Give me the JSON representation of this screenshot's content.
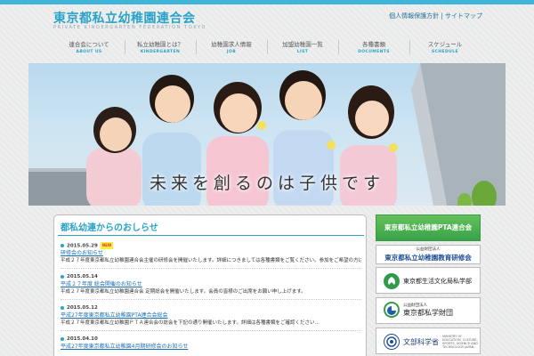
{
  "header": {
    "logo_title": "東京都私立幼稚園連合会",
    "logo_subtitle": "PRIVATE KINDERGARTEN FEDERATION TOKYO",
    "links": [
      "個人情報保護方針",
      "サイトマップ"
    ],
    "link_separator": "|"
  },
  "nav": [
    {
      "ja": "連合会について",
      "en": "ABOUT US"
    },
    {
      "ja": "私立幼稚園とは？",
      "en": "KINDERGARTEN"
    },
    {
      "ja": "幼稚園求人情報",
      "en": "JOB"
    },
    {
      "ja": "加盟幼稚園一覧",
      "en": "LIST"
    },
    {
      "ja": "各種書類",
      "en": "DOCUMENTS"
    },
    {
      "ja": "スケジュール",
      "en": "SCHEDULE"
    }
  ],
  "hero": {
    "caption": "未来を創るのは子供です"
  },
  "news": {
    "title": "都私幼連からのおしらせ",
    "items": [
      {
        "date": "2015.05.29",
        "badge": "NEW",
        "link": "研修会のお知らせ",
        "body": "平成２７年度東京都私立幼稚園連合会主催の研修会を開催いたします。詳細につきましては各種書類をご覧ください。参加をご希望の方は　…　詳細"
      },
      {
        "date": "2015.05.14",
        "badge": "",
        "link": "平成２７年度 総会開催のお知らせ",
        "body": "平成２７年度東京都私立幼稚園連合会 定期総会を開催いたします。会員の皆様のご出席をお願い申し上げます。"
      },
      {
        "date": "2015.05.12",
        "badge": "",
        "link": "平成27年度東京都私立幼稚園PTA連合会総会",
        "body": "平成２７年度東京都私立幼稚園ＰＴＡ連合会の総会を下記の通り開催いたします。詳細は各種書類をご確認ください…"
      },
      {
        "date": "2015.04.10",
        "badge": "",
        "link": "平成27年度東京都私立幼稚園4月期研修会のお知らせ",
        "body": ""
      }
    ]
  },
  "sidebar": {
    "pta_banner": "東京都私立幼稚園PTA連合会",
    "research_banner": {
      "small": "公益財団法人",
      "big": "東京都私立幼稚園教育研修会"
    },
    "bureau_banner": "東京都生活文化局私学部",
    "foundation_banner": {
      "small": "公益財団法人",
      "big": "東京都私学財団"
    },
    "mext_banner": {
      "big": "文部科学省",
      "sub": "MINISTRY OF EDUCATION, CULTURE, SPORTS, SCIENCE AND TECHNOLOGY-JAPAN"
    }
  },
  "colors": {
    "accent": "#2aa3c9",
    "top_bar": "#3fb6d8",
    "green_banner": "#4cb050",
    "link": "#1a6fb3"
  }
}
